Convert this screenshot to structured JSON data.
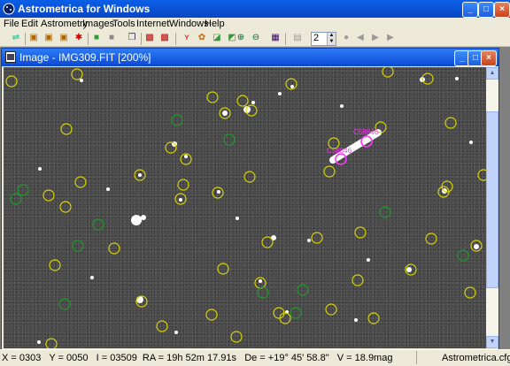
{
  "app": {
    "title": "Astrometrica for Windows"
  },
  "menu": [
    "File",
    "Edit",
    "Astrometry",
    "Images",
    "Tools",
    "Internet",
    "Windows",
    "Help"
  ],
  "toolbar": {
    "frame_value": "2"
  },
  "image_window": {
    "title": "Image - IMG309.FIT [200%]"
  },
  "annotations": {
    "label_a": "C58846",
    "label_b": "C58846"
  },
  "status": {
    "readout": "X = 0303   Y = 0050   I = 03509  RA = 19h 52m 17.91s   De = +19° 45' 58.8\"   V = 18.9mag",
    "config": "Astrometrica.cfg"
  },
  "colors": {
    "titlebar": "#0a5fe8",
    "yellow_circle": "#d8d400",
    "green_circle": "#1e9a2a",
    "magenta": "#ff33ff"
  }
}
